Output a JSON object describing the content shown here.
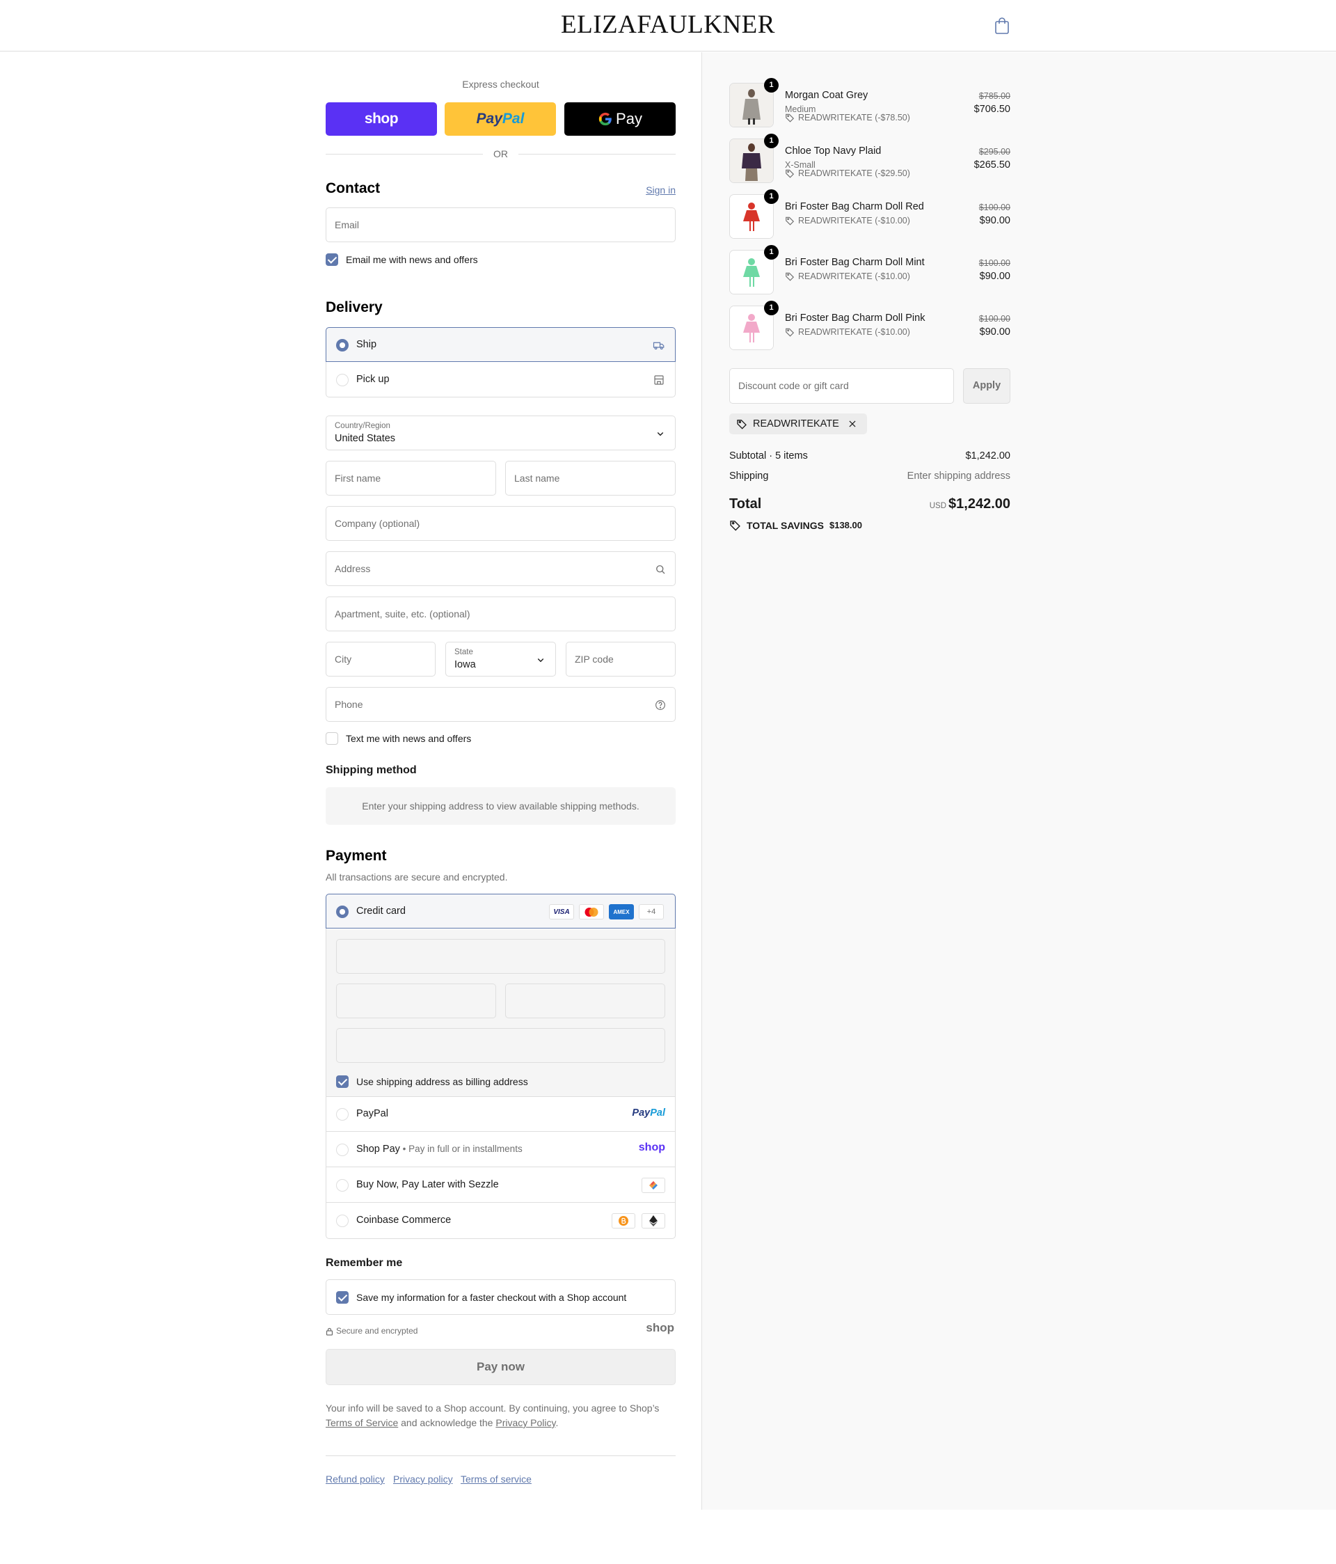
{
  "header": {
    "brand": "ELIZAFAULKNER",
    "cart_icon": "shopping-bag-icon"
  },
  "express": {
    "label": "Express checkout",
    "shop_label": "shop",
    "paypal_label_1": "Pay",
    "paypal_label_2": "Pal",
    "gpay_label": "Pay",
    "or_label": "OR"
  },
  "contact": {
    "title": "Contact",
    "sign_in": "Sign in",
    "email_placeholder": "Email",
    "news_label": "Email me with news and offers",
    "news_checked": true
  },
  "delivery": {
    "title": "Delivery",
    "options": [
      {
        "label": "Ship",
        "selected": true,
        "icon": "truck-icon"
      },
      {
        "label": "Pick up",
        "selected": false,
        "icon": "store-icon"
      }
    ],
    "country_label": "Country/Region",
    "country_value": "United States",
    "first_name_placeholder": "First name",
    "last_name_placeholder": "Last name",
    "company_placeholder": "Company (optional)",
    "address_placeholder": "Address",
    "apartment_placeholder": "Apartment, suite, etc. (optional)",
    "city_placeholder": "City",
    "state_label": "State",
    "state_value": "Iowa",
    "zip_placeholder": "ZIP code",
    "phone_placeholder": "Phone",
    "text_label": "Text me with news and offers",
    "text_checked": false
  },
  "shipping_method": {
    "title": "Shipping method",
    "info": "Enter your shipping address to view available shipping methods."
  },
  "payment": {
    "title": "Payment",
    "subtitle": "All transactions are secure and encrypted.",
    "credit_card_label": "Credit card",
    "card_badges": [
      "VISA",
      "",
      "AMEX",
      "+4"
    ],
    "billing_label": "Use shipping address as billing address",
    "billing_checked": true,
    "paypal_label": "PayPal",
    "paypal_logo_1": "Pay",
    "paypal_logo_2": "Pal",
    "shoppay_label": "Shop Pay",
    "shoppay_sub": "Pay in full or in installments",
    "shoppay_logo": "shop",
    "sezzle_label": "Buy Now, Pay Later with Sezzle",
    "coinbase_label": "Coinbase Commerce"
  },
  "remember": {
    "title": "Remember me",
    "save_label": "Save my information for a faster checkout with a Shop account",
    "save_checked": true,
    "secure_label": "Secure and encrypted",
    "shop_logo": "shop"
  },
  "pay_now_label": "Pay now",
  "legal": {
    "text_1": "Your info will be saved to a Shop account. By continuing, you agree to Shop’s",
    "terms_link": "Terms of Service",
    "text_2": "and acknowledge the",
    "privacy_link": "Privacy Policy",
    "text_3": "."
  },
  "footer_links": [
    "Refund policy",
    "Privacy policy",
    "Terms of service"
  ],
  "summary": {
    "items": [
      {
        "name": "Morgan Coat Grey",
        "variant": "Medium",
        "discount": "READWRITEKATE (-$78.50)",
        "old_price": "$785.00",
        "price": "$706.50",
        "qty": "1",
        "color": "#9e9a94"
      },
      {
        "name": "Chloe Top Navy Plaid",
        "variant": "X-Small",
        "discount": "READWRITEKATE (-$29.50)",
        "old_price": "$295.00",
        "price": "$265.50",
        "qty": "1",
        "color": "#3b2a45"
      },
      {
        "name": "Bri Foster Bag Charm Doll Red",
        "variant": "",
        "discount": "READWRITEKATE (-$10.00)",
        "old_price": "$100.00",
        "price": "$90.00",
        "qty": "1",
        "color": "#d8352a"
      },
      {
        "name": "Bri Foster Bag Charm Doll Mint",
        "variant": "",
        "discount": "READWRITEKATE (-$10.00)",
        "old_price": "$100.00",
        "price": "$90.00",
        "qty": "1",
        "color": "#6fd9a4"
      },
      {
        "name": "Bri Foster Bag Charm Doll Pink",
        "variant": "",
        "discount": "READWRITEKATE (-$10.00)",
        "old_price": "$100.00",
        "price": "$90.00",
        "qty": "1",
        "color": "#f2a9c9"
      }
    ],
    "discount_placeholder": "Discount code or gift card",
    "apply_label": "Apply",
    "applied_code": "READWRITEKATE",
    "subtotal_label": "Subtotal · 5 items",
    "subtotal_value": "$1,242.00",
    "shipping_label": "Shipping",
    "shipping_value": "Enter shipping address",
    "total_label": "Total",
    "currency": "USD",
    "total_value": "$1,242.00",
    "savings_label": "TOTAL SAVINGS",
    "savings_value": "$138.00"
  },
  "colors": {
    "accent": "#6079ad",
    "shop_purple": "#5a31f4",
    "paypal_yellow": "#ffc439"
  }
}
